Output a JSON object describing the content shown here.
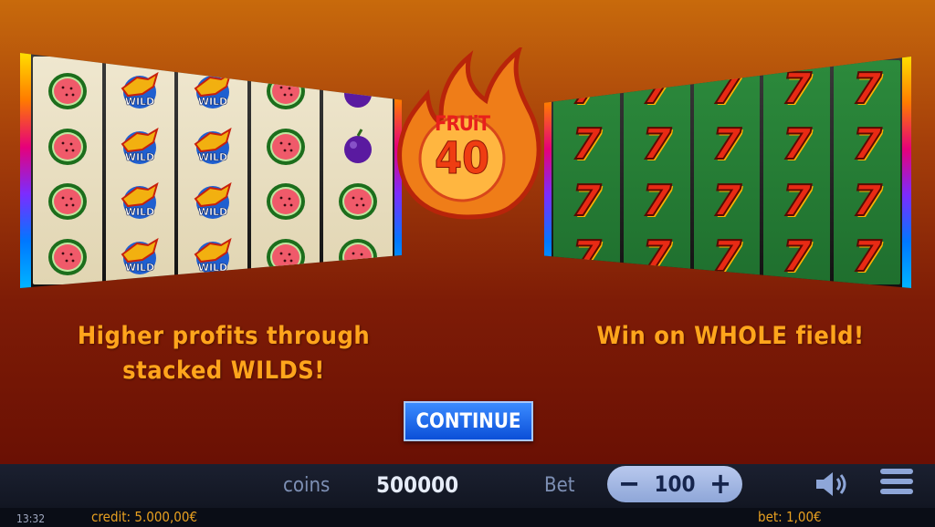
{
  "logo": {
    "line1": "FRUiT",
    "line2": "40"
  },
  "left_panel": {
    "caption_line1": "Higher profits through",
    "caption_line2": "stacked WILDS!",
    "wild_label": "WILD",
    "reels": [
      [
        "watermelon",
        "watermelon",
        "watermelon",
        "watermelon"
      ],
      [
        "wild",
        "wild",
        "wild",
        "wild"
      ],
      [
        "wild",
        "wild",
        "wild",
        "wild"
      ],
      [
        "watermelon",
        "watermelon",
        "watermelon",
        "watermelon"
      ],
      [
        "plum",
        "plum",
        "watermelon",
        "watermelon"
      ]
    ]
  },
  "right_panel": {
    "caption": "Win on WHOLE field!",
    "symbol": "7"
  },
  "continue_label": "CONTINUE",
  "bottom_bar": {
    "coins_label": "coins",
    "coins_value": "500000",
    "bet_label": "Bet",
    "bet_value": "100",
    "minus": "−",
    "plus": "+"
  },
  "status": {
    "clock": "13:32",
    "credit": "credit: 5.000,00€",
    "bet": "bet: 1,00€"
  },
  "colors": {
    "accent_text": "#ffa51c",
    "button_blue": "#1a63e8",
    "status_text": "#e8a020"
  }
}
